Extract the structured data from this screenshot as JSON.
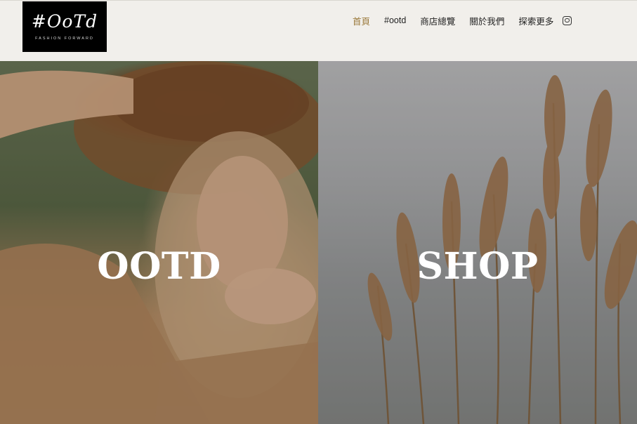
{
  "logo": {
    "mark": "#OoTd",
    "tagline": "FASHION FORWARD"
  },
  "nav": {
    "items": [
      {
        "label": "首頁",
        "active": true
      },
      {
        "label": "#ootd",
        "active": false
      },
      {
        "label": "商店總覽",
        "active": false
      },
      {
        "label": "關於我們",
        "active": false
      },
      {
        "label": "探索更多",
        "active": false
      }
    ],
    "social_icon": "instagram-icon"
  },
  "panels": {
    "ootd": {
      "title": "OOTD"
    },
    "shop": {
      "title": "SHOP"
    }
  },
  "colors": {
    "active_nav": "#9b7a3c",
    "header_bg": "#f1efeb",
    "logo_bg": "#000000"
  }
}
